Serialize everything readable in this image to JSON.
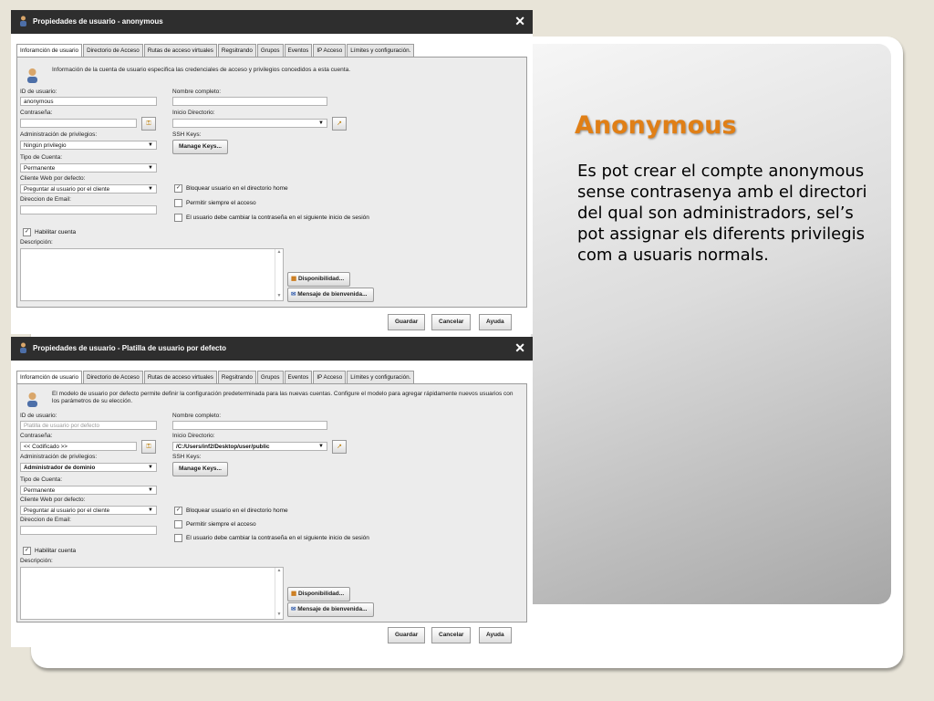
{
  "slide": {
    "title": "Anonymous",
    "body": "Es pot crear el compte anonymous sense contrasenya amb el directori del qual son administradors, sel’s pot assignar els diferents privilegis com a usuaris normals."
  },
  "dialog1": {
    "title": "Propiedades de usuario - anonymous",
    "close": "✕",
    "tabs": [
      "Inforamción de usuario",
      "Directorio de Acceso",
      "Rutas de acceso virtuales",
      "Regsitrando",
      "Grupos",
      "Eventos",
      "IP Acceso",
      "Límites y configuración."
    ],
    "info": "Información de la cuenta de usuario especifica las credenciales de acceso y privilegios concedidos a esta cuenta.",
    "user_id_label": "ID de usuario:",
    "user_id_value": "anonymous",
    "fullname_label": "Nombre completo:",
    "fullname_value": "",
    "password_label": "Contraseña:",
    "password_value": "",
    "home_label": "Inicio Directorio:",
    "home_value": "",
    "priv_label": "Administración de privilegios:",
    "priv_value": "Ningún privilegio",
    "ssh_label": "SSH Keys:",
    "ssh_button": "Manage Keys...",
    "account_type_label": "Tipo de Cuenta:",
    "account_type_value": "Permanente",
    "webclient_label": "Cliente Web por defecto:",
    "webclient_value": "Preguntar al usuario por el cliente",
    "email_label": "Direccion de Email:",
    "email_value": "",
    "cb_lock_home": "Bloquear usuario en el directorio home",
    "cb_always_allow": "Permitir siempre el acceso",
    "cb_change_pw": "El usuario debe cambiar la contraseña en el siguiente inicio de sesión",
    "cb_enable": "Habilitar cuenta",
    "desc_label": "Descripción:",
    "availability_button": "Disponibilidad...",
    "welcome_button": "Mensaje de bienvenida...",
    "save": "Guardar",
    "cancel": "Cancelar",
    "help": "Ayuda"
  },
  "dialog2": {
    "title": "Propiedades de usuario - Platilla de usuario por defecto",
    "close": "✕",
    "tabs": [
      "Inforamción de usuario",
      "Directorio de Acceso",
      "Rutas de acceso virtuales",
      "Regsitrando",
      "Grupos",
      "Eventos",
      "IP Acceso",
      "Límites y configuración."
    ],
    "info": "El modelo de usuario por defecto permite definir la configuración predeterminada para las nuevas cuentas. Configure el modelo para agregar rápidamente nuevos usuarios con los parámetros de su elección.",
    "user_id_label": "ID de usuario:",
    "user_id_value": "Platilla de usuario por defecto",
    "fullname_label": "Nombre completo:",
    "fullname_value": "",
    "password_label": "Contraseña:",
    "password_value": "<< Codificado >>",
    "home_label": "Inicio Directorio:",
    "home_value": "/C:/Users/inf2/Desktop/user/public",
    "priv_label": "Administración de privilegios:",
    "priv_value": "Administrador de dominio",
    "ssh_label": "SSH Keys:",
    "ssh_button": "Manage Keys...",
    "account_type_label": "Tipo de Cuenta:",
    "account_type_value": "Permanente",
    "webclient_label": "Cliente Web por defecto:",
    "webclient_value": "Preguntar al usuario por el cliente",
    "email_label": "Direccion de Email:",
    "email_value": "",
    "cb_lock_home": "Bloquear usuario en el directorio home",
    "cb_always_allow": "Permitir siempre el acceso",
    "cb_change_pw": "El usuario debe cambiar la contraseña en el siguiente inicio de sesión",
    "cb_enable": "Habilitar cuenta",
    "desc_label": "Descripción:",
    "availability_button": "Disponibilidad...",
    "welcome_button": "Mensaje de bienvenida...",
    "save": "Guardar",
    "cancel": "Cancelar",
    "help": "Ayuda"
  },
  "icons": {
    "user": "user-icon",
    "password_generate": "key-icon",
    "browse_folder": "folder-icon",
    "availability": "calendar-icon",
    "welcome": "message-icon"
  },
  "colors": {
    "title_accent": "#e07f16",
    "titlebar": "#2e2e2e",
    "panel": "#ececec"
  }
}
